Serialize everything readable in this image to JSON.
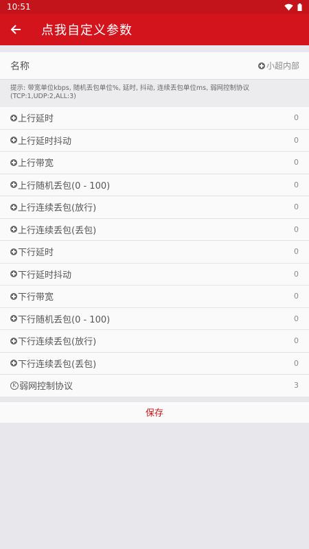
{
  "status": {
    "time": "10:51"
  },
  "appbar": {
    "title": "点我自定义参数"
  },
  "name_row": {
    "label": "名称",
    "value": "小超内部"
  },
  "hint": "提示: 带宽单位kbps, 随机丢包单位%, 延时, 抖动, 连续丢包单位ms, 弱网控制协议(TCP:1,UDP:2,ALL:3)",
  "params": [
    {
      "label": "上行延时",
      "value": "0"
    },
    {
      "label": "上行延时抖动",
      "value": "0"
    },
    {
      "label": "上行带宽",
      "value": "0"
    },
    {
      "label": "上行随机丢包(0 - 100)",
      "value": "0"
    },
    {
      "label": "上行连续丢包(放行)",
      "value": "0"
    },
    {
      "label": "上行连续丢包(丢包)",
      "value": "0"
    },
    {
      "label": "下行延时",
      "value": "0"
    },
    {
      "label": "下行延时抖动",
      "value": "0"
    },
    {
      "label": "下行带宽",
      "value": "0"
    },
    {
      "label": "下行随机丢包(0 - 100)",
      "value": "0"
    },
    {
      "label": "下行连续丢包(放行)",
      "value": "0"
    },
    {
      "label": "下行连续丢包(丢包)",
      "value": "0"
    }
  ],
  "protocol": {
    "icon_letter": "K",
    "label": "弱网控制协议",
    "value": "3"
  },
  "save_label": "保存",
  "colors": {
    "primary": "#d4141c",
    "status_bar": "#c4141b",
    "background": "#e8e8ec"
  }
}
